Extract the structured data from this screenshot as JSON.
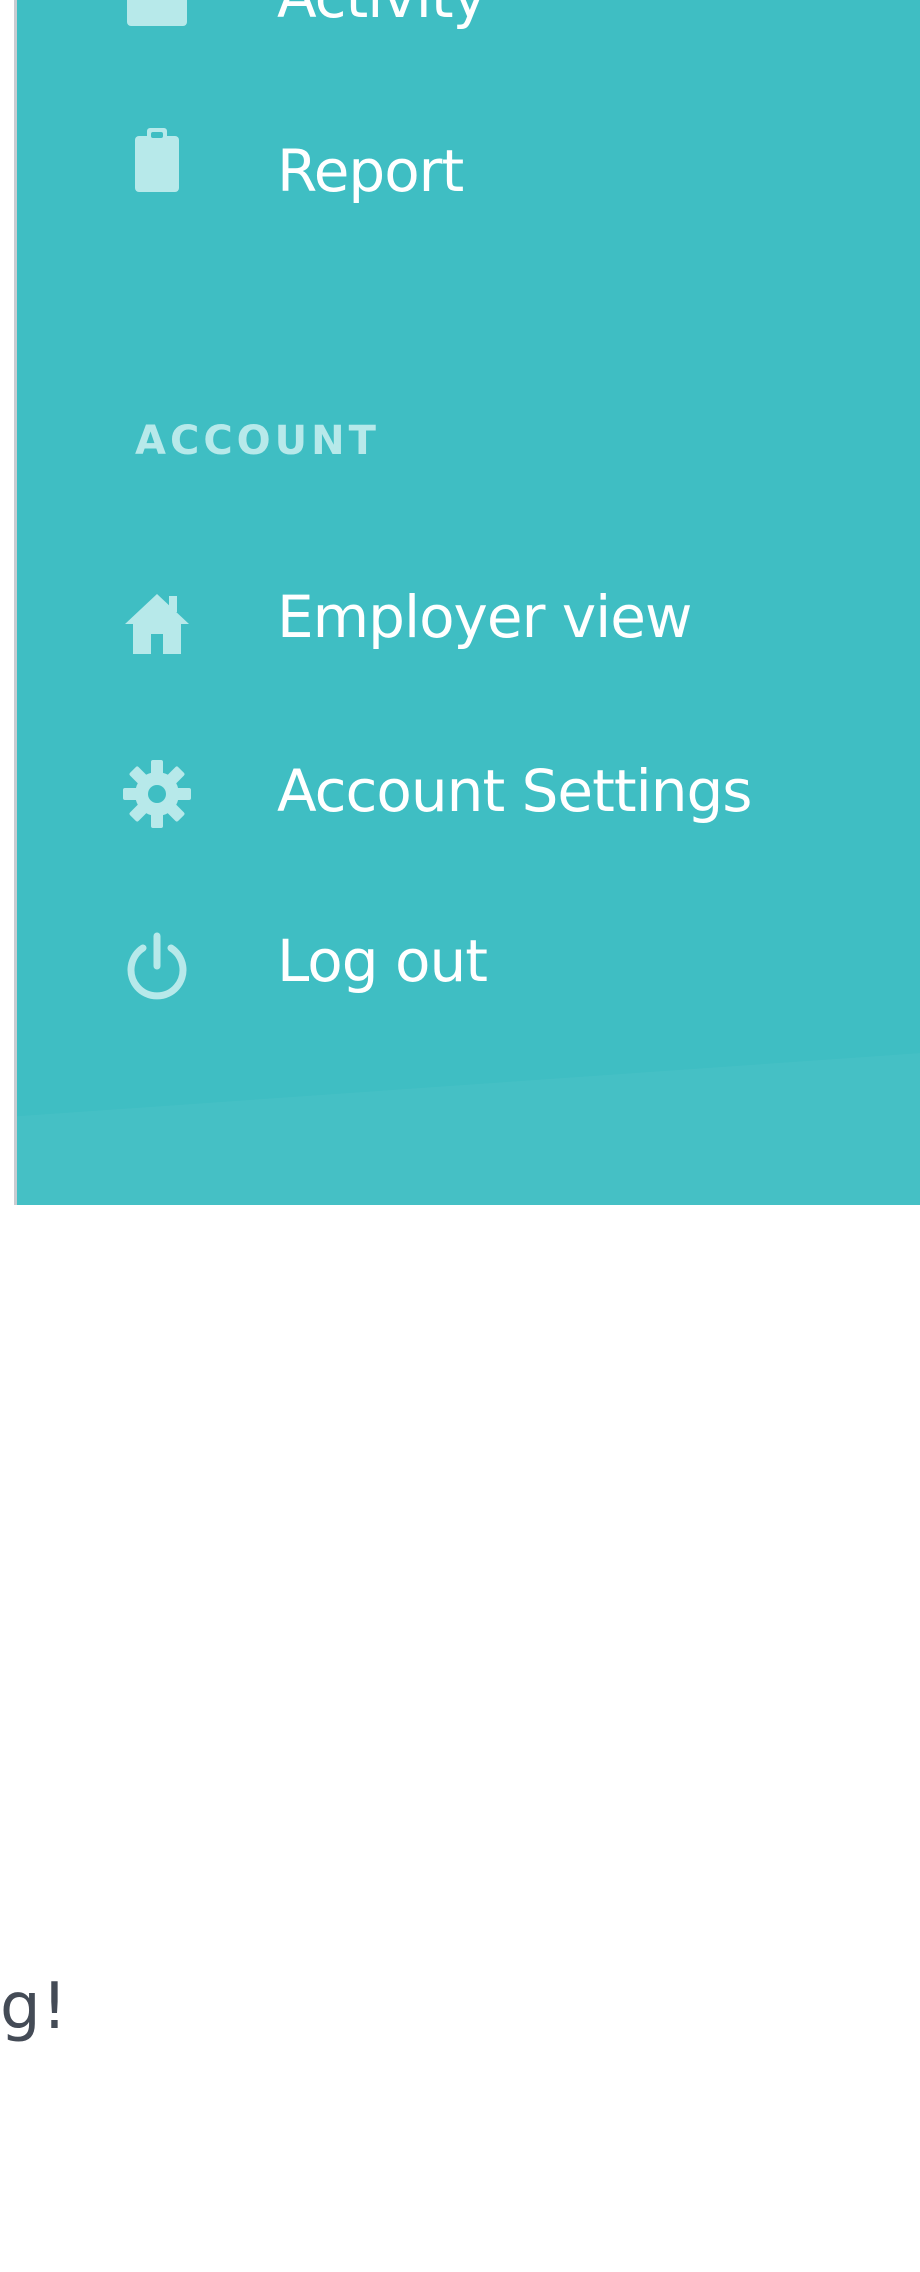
{
  "sidebar": {
    "items_top": [
      {
        "label": "Activity",
        "icon": "inbox-icon"
      },
      {
        "label": "Report",
        "icon": "clipboard-icon"
      }
    ],
    "account_section": {
      "title": "ACCOUNT",
      "items": [
        {
          "label": "Employer view",
          "icon": "home-icon"
        },
        {
          "label": "Account Settings",
          "icon": "gear-icon"
        },
        {
          "label": "Log out",
          "icon": "power-icon"
        }
      ]
    },
    "colors": {
      "background": "#3fbec3",
      "icon": "#b7e9ea",
      "text": "#ffffff"
    }
  },
  "page": {
    "partial_text": "g!"
  }
}
